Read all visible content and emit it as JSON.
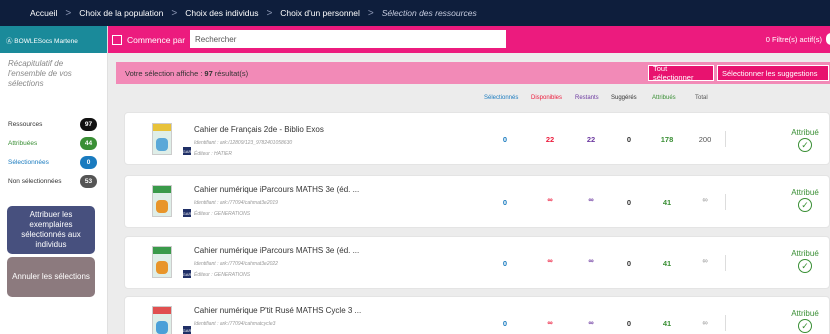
{
  "breadcrumb": {
    "items": [
      "Accueil",
      "Choix de la population",
      "Choix des individus",
      "Choix d'un personnel"
    ],
    "current": "Sélection des ressources",
    "separator": ">"
  },
  "sidebar": {
    "user": "Ⓐ BOWLESocs Martene",
    "recap": "Récapitulatif de l'ensemble de vos sélections",
    "stats": [
      {
        "label": "Ressources",
        "count": "97"
      },
      {
        "label": "Attribuées",
        "count": "44"
      },
      {
        "label": "Sélectionnées",
        "count": "0"
      },
      {
        "label": "Non sélectionnées",
        "count": "53"
      }
    ],
    "assign_button": "Attribuer les exemplaires sélectionnés aux individus",
    "cancel_button": "Annuler les sélections"
  },
  "search": {
    "label": "Commence par",
    "placeholder": "Rechercher",
    "filters": "0 Filtre(s) actif(s)"
  },
  "banner": {
    "prefix": "Votre sélection affiche :",
    "count": "97",
    "suffix": "résultat(s)",
    "select_all": "Tout sélectionner",
    "select_suggestions": "Sélectionner les suggestions"
  },
  "columns": [
    "Sélectionnés",
    "Disponibles",
    "Restants",
    "Suggérés",
    "Attribués",
    "Total"
  ],
  "resources": [
    {
      "title": "Cahier de Français 2de - Biblio Exos",
      "identifier": "Identifiant : ark:/12809/123_9782401058630",
      "editor": "Éditeur : HATIER",
      "selected": "0",
      "available": "22",
      "remaining": "22",
      "suggested": "0",
      "assigned": "178",
      "total": "200",
      "status": "Attribué"
    },
    {
      "title": "Cahier numérique iParcours MATHS 3e (éd. ...",
      "identifier": "Identifiant : ark:/77094/cahmat3e2019",
      "editor": "Éditeur : GENERATIONS",
      "selected": "0",
      "available": "∞",
      "remaining": "∞",
      "suggested": "0",
      "assigned": "41",
      "total": "∞",
      "status": "Attribué"
    },
    {
      "title": "Cahier numérique iParcours MATHS 3e (éd. ...",
      "identifier": "Identifiant : ark:/77094/cahmat3e2022",
      "editor": "Éditeur : GENERATIONS",
      "selected": "0",
      "available": "∞",
      "remaining": "∞",
      "suggested": "0",
      "assigned": "41",
      "total": "∞",
      "status": "Attribué"
    },
    {
      "title": "Cahier numérique P'tit Rusé MATHS Cycle 3 ...",
      "identifier": "Identifiant : ark:/77094/cahmatcycle3",
      "editor": "",
      "selected": "0",
      "available": "∞",
      "remaining": "∞",
      "suggested": "0",
      "assigned": "41",
      "total": "∞",
      "status": "Attribué"
    }
  ],
  "colors": {
    "topbar": "#0e1e3c",
    "pink": "#ec1b7e",
    "banner": "#f28ab7",
    "teal": "#1a8a9a",
    "green": "#3a8f35",
    "blue": "#1a7bbf",
    "red": "#ec1b3c",
    "purple": "#6d3aa0"
  },
  "icons": {
    "check": "check-circle-icon",
    "gar": "gar-badge-icon"
  }
}
